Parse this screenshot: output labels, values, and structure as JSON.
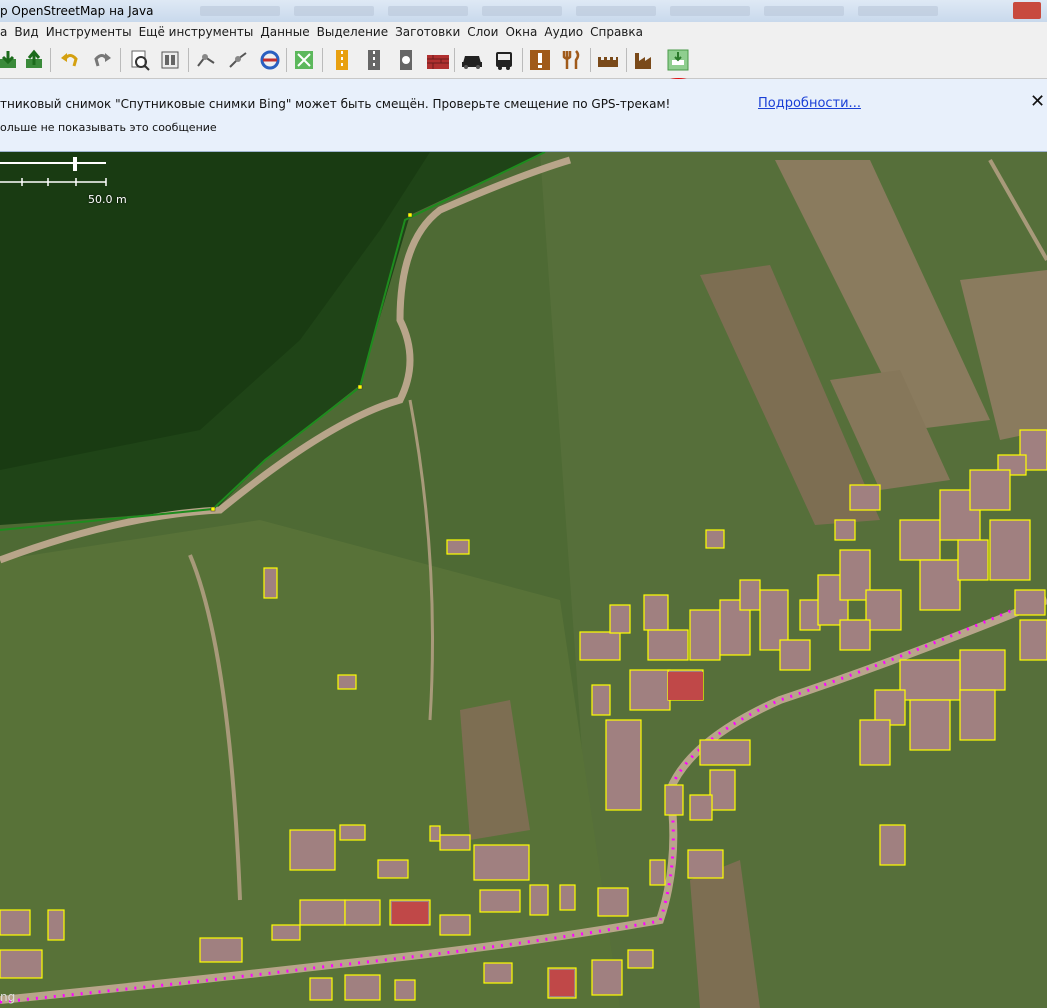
{
  "window": {
    "title": "p OpenStreetMap на Java"
  },
  "menu": [
    "а",
    "Вид",
    "Инструменты",
    "Ещё инструменты",
    "Данные",
    "Выделение",
    "Заготовки",
    "Слои",
    "Окна",
    "Аудио",
    "Справка"
  ],
  "toolbar": {
    "icons": [
      "download-icon",
      "upload-icon",
      "undo-icon",
      "redo-icon",
      "zoom-icon",
      "preferences-icon",
      "split-way-icon",
      "combine-way-icon",
      "reverse-icon",
      "orthogonalize-icon",
      "road-icon",
      "track-icon",
      "traffic-signal-icon",
      "barrier-icon",
      "car-icon",
      "bus-icon",
      "amenity-icon",
      "restaurant-icon",
      "castle-icon",
      "factory-icon",
      "plugin-icon"
    ]
  },
  "notice": {
    "message": "тниковый снимок \"Спутниковые снимки Bing\" может быть смещён. Проверьте смещение по GPS-трекам!",
    "more_link": "Подробности...",
    "close": "✕",
    "dont_show": "ольше не показывать это сообщение"
  },
  "map": {
    "scale_label": "50.0 m",
    "corner_label": "ng",
    "colors": {
      "forest": "#1f4417",
      "field": "#4e6a34",
      "landuse_line": "#1e8c1e",
      "node": "#ffff00",
      "gps": "#ff00ff",
      "building": "#a08080",
      "road": "#b8a58a"
    }
  }
}
